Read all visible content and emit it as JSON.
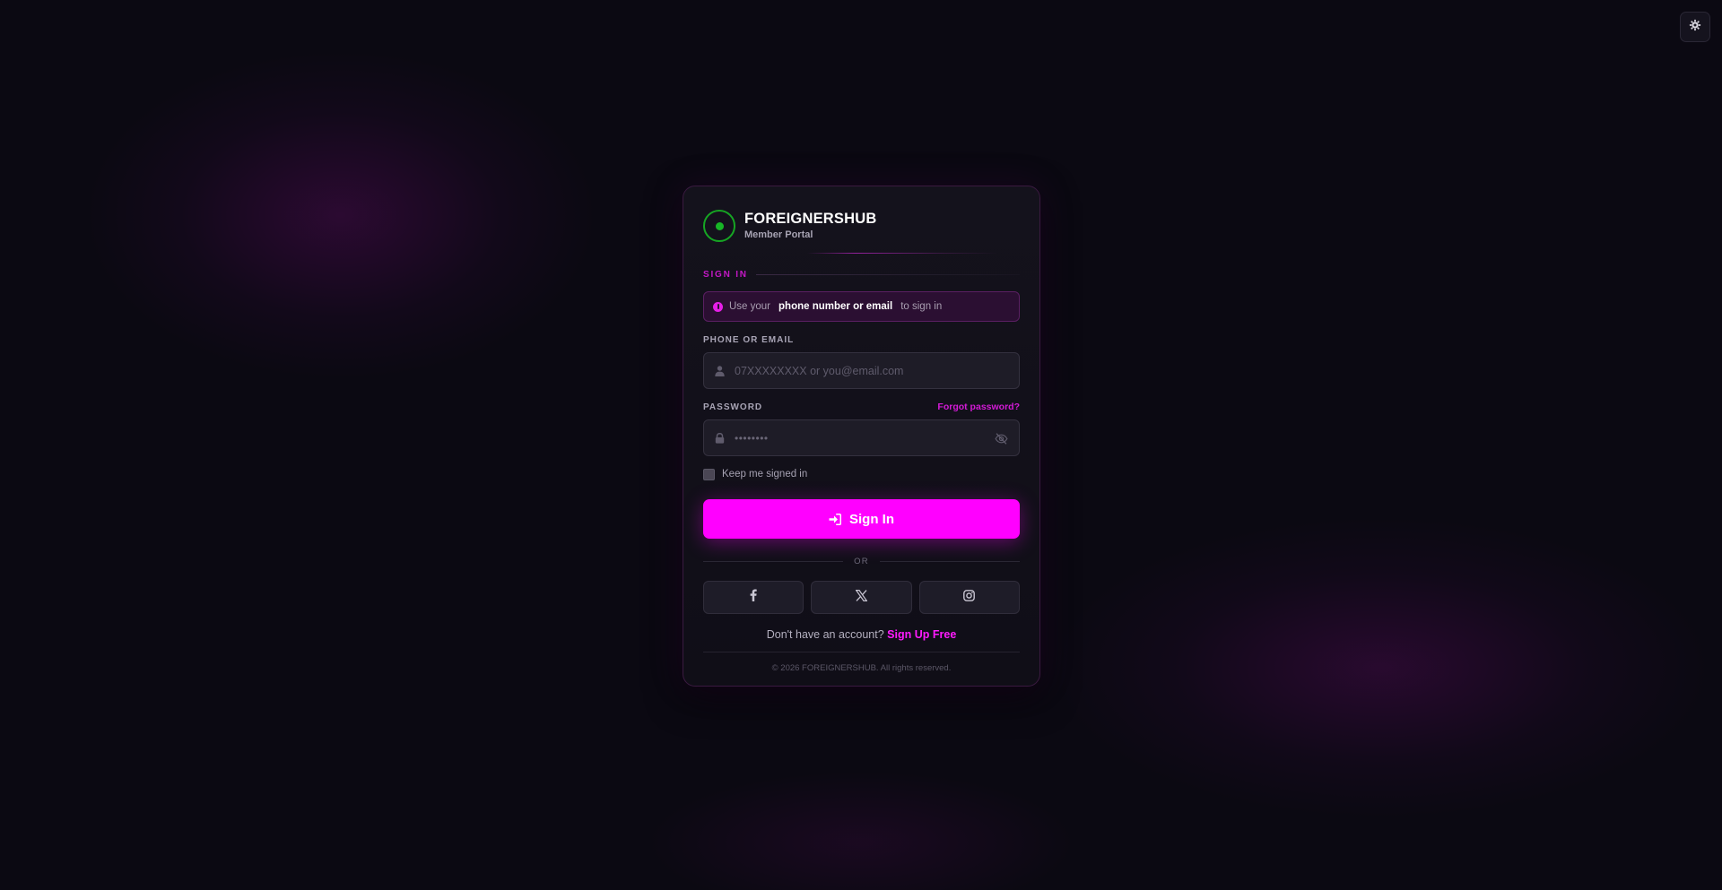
{
  "brand": {
    "name": "FOREIGNERSHUB",
    "subtitle": "Member Portal"
  },
  "section": {
    "title": "SIGN IN"
  },
  "hint": {
    "prefix": "Use your",
    "emphasis": "phone number or email",
    "suffix": "to sign in"
  },
  "identifier": {
    "label": "PHONE OR EMAIL",
    "placeholder": "07XXXXXXXX or you@email.com",
    "value": ""
  },
  "password": {
    "label": "PASSWORD",
    "forgot_label": "Forgot password?",
    "placeholder": "••••••••",
    "value": ""
  },
  "remember": {
    "label": "Keep me signed in",
    "checked": false
  },
  "signin_button": {
    "label": "Sign In"
  },
  "divider": {
    "text": "OR"
  },
  "social": [
    {
      "icon": "facebook-icon"
    },
    {
      "icon": "x-icon"
    },
    {
      "icon": "instagram-icon"
    }
  ],
  "signup": {
    "prompt": "Don't have an account?",
    "link": "Sign Up Free"
  },
  "footer": {
    "copyright": "© 2026 FOREIGNERSHUB. All rights reserved."
  },
  "colors": {
    "accent": "#ff00ff",
    "brand_green": "#17b526",
    "background": "#0b0912"
  },
  "icons": {
    "theme_toggle": "gear-icon",
    "hint": "info-icon",
    "identifier": "user-icon",
    "password": "lock-icon",
    "password_toggle": "eye-slash-icon",
    "signin": "sign-in-icon"
  }
}
